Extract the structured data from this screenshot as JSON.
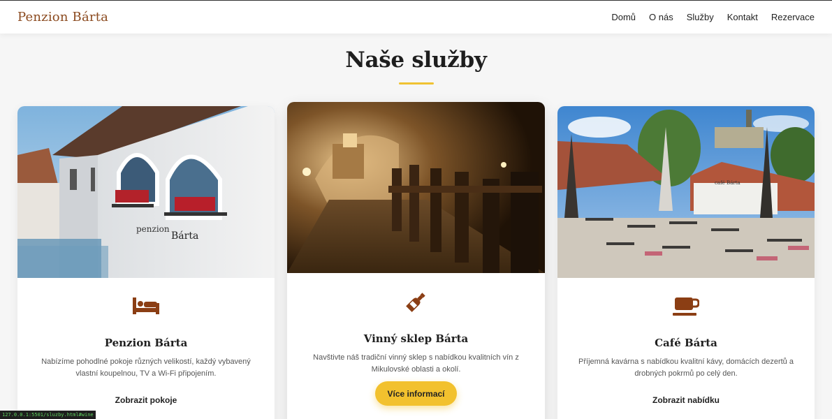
{
  "header": {
    "brand": "Penzion Bárta",
    "nav": [
      {
        "label": "Domů"
      },
      {
        "label": "O nás"
      },
      {
        "label": "Služby"
      },
      {
        "label": "Kontakt"
      },
      {
        "label": "Rezervace"
      }
    ]
  },
  "section": {
    "title": "Naše služby",
    "accent_color": "#f0c232"
  },
  "cards": [
    {
      "title": "Penzion Bárta",
      "icon": "bed-icon",
      "description": "Nabízíme pohodlné pokoje různých velikostí, každý vybavený vlastní koupelnou, TV a Wi-Fi připojením.",
      "link": "Zobrazit pokoje"
    },
    {
      "title": "Vinný sklep Bárta",
      "icon": "wine-bottle-icon",
      "description": "Navštivte náš tradiční vinný sklep s nabídkou kvalitních vín z Mikulovské oblasti a okolí.",
      "button": "Více informací"
    },
    {
      "title": "Café Bárta",
      "icon": "coffee-cup-icon",
      "description": "Příjemná kavárna s nabídkou kvalitní kávy, domácích dezertů a drobných pokrmů po celý den.",
      "link": "Zobrazit nabídku"
    }
  ],
  "colors": {
    "brand": "#8b4a1f",
    "icon": "#8b3e14",
    "button": "#f2c12e"
  },
  "status_url": "127.0.0.1:5501/sluzby.html#wine"
}
